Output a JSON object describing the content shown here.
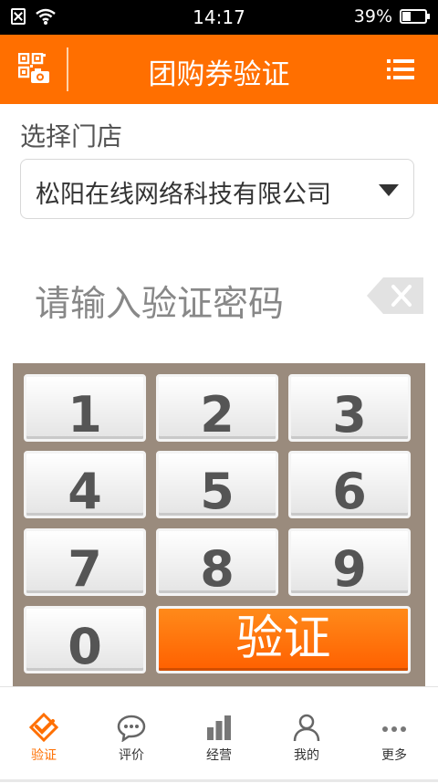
{
  "status_bar": {
    "time": "14:17",
    "battery": "39%",
    "battery_level": 0.39
  },
  "header": {
    "title": "团购券验证"
  },
  "store": {
    "label": "选择门店",
    "selected": "松阳在线网络科技有限公司"
  },
  "password": {
    "placeholder": "请输入验证密码"
  },
  "keypad": {
    "keys": [
      "1",
      "2",
      "3",
      "4",
      "5",
      "6",
      "7",
      "8",
      "9",
      "0"
    ],
    "verify_label": "验证"
  },
  "bottom_nav": {
    "items": [
      {
        "label": "验证",
        "icon": "verify-icon",
        "active": true
      },
      {
        "label": "评价",
        "icon": "comment-icon",
        "active": false
      },
      {
        "label": "经营",
        "icon": "bar-chart-icon",
        "active": false
      },
      {
        "label": "我的",
        "icon": "user-icon",
        "active": false
      },
      {
        "label": "更多",
        "icon": "more-icon",
        "active": false
      }
    ]
  },
  "colors": {
    "accent": "#ff6f00",
    "keypad_bg": "#9a8b7d"
  }
}
